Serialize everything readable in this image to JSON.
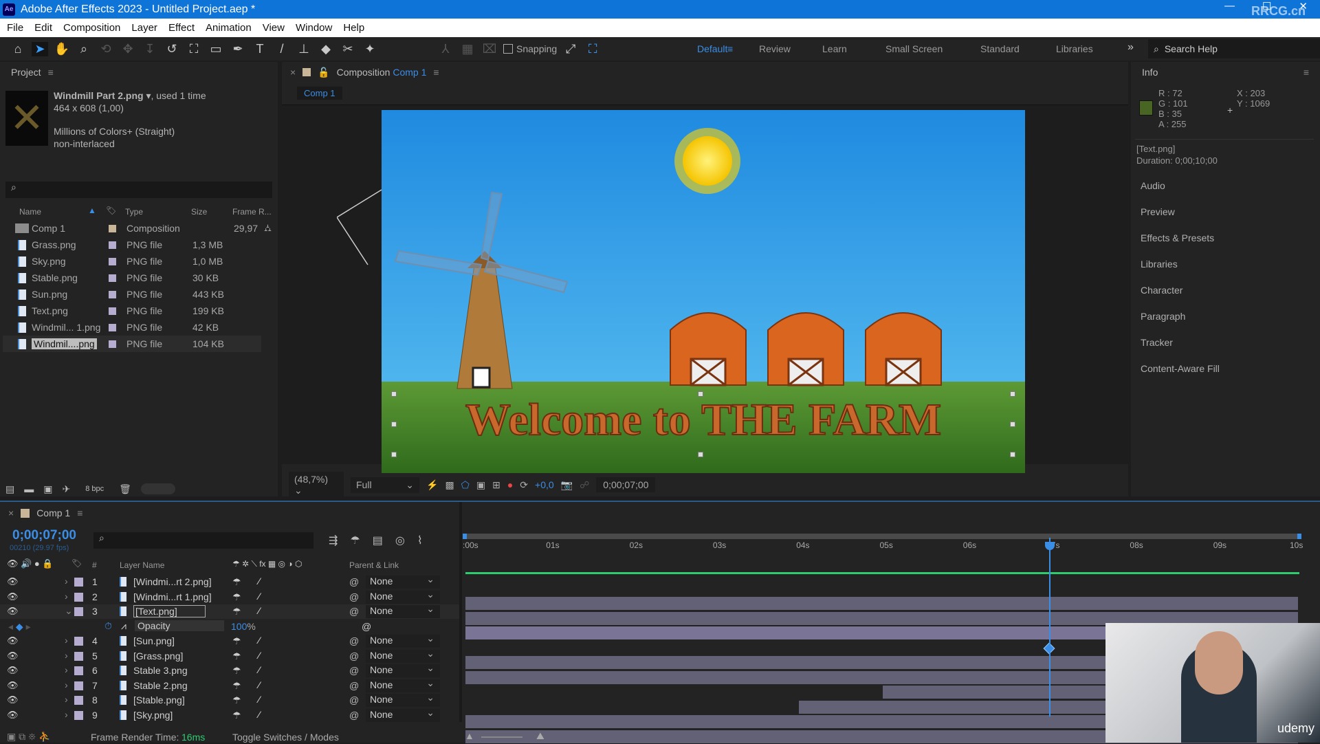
{
  "window": {
    "title": "Adobe After Effects 2023 - Untitled Project.aep *",
    "app_badge": "Ae",
    "watermark": "RRCG.cn"
  },
  "menu": [
    "File",
    "Edit",
    "Composition",
    "Layer",
    "Effect",
    "Animation",
    "View",
    "Window",
    "Help"
  ],
  "toolbar": {
    "snapping_label": "Snapping",
    "workspaces": [
      "Default",
      "Review",
      "Learn",
      "Small Screen",
      "Standard",
      "Libraries"
    ],
    "active_workspace": "Default",
    "search_placeholder": "Search Help"
  },
  "project": {
    "title": "Project",
    "selected": {
      "name": "Windmill Part 2.png",
      "used": ", used 1 time",
      "dims": "464 x 608 (1,00)",
      "colors": "Millions of Colors+ (Straight)",
      "interlace": "non-interlaced"
    },
    "columns": {
      "name": "Name",
      "type": "Type",
      "size": "Size",
      "frame_rate": "Frame R..."
    },
    "items": [
      {
        "name": "Comp 1",
        "type": "Composition",
        "size": "",
        "fr": "29,97",
        "kind": "comp"
      },
      {
        "name": "Grass.png",
        "type": "PNG file",
        "size": "1,3 MB",
        "fr": ""
      },
      {
        "name": "Sky.png",
        "type": "PNG file",
        "size": "1,0 MB",
        "fr": ""
      },
      {
        "name": "Stable.png",
        "type": "PNG file",
        "size": "30 KB",
        "fr": ""
      },
      {
        "name": "Sun.png",
        "type": "PNG file",
        "size": "443 KB",
        "fr": ""
      },
      {
        "name": "Text.png",
        "type": "PNG file",
        "size": "199 KB",
        "fr": ""
      },
      {
        "name": "Windmil... 1.png",
        "type": "PNG file",
        "size": "42 KB",
        "fr": ""
      },
      {
        "name": "Windmil....png",
        "type": "PNG file",
        "size": "104 KB",
        "fr": "",
        "selected": true
      }
    ],
    "bpc": "8 bpc"
  },
  "composition": {
    "panel_label": "Composition",
    "comp_name": "Comp 1",
    "tab": "Comp 1",
    "zoom": "(48,7%)",
    "resolution": "Full",
    "exposure": "+0,0",
    "timecode": "0;00;07;00",
    "scene_text": "Welcome to THE FARM"
  },
  "info": {
    "title": "Info",
    "r": "R : 72",
    "g": "G : 101",
    "b": "B : 35",
    "a": "A : 255",
    "x": "X : 203",
    "y": "Y : 1069",
    "swatch": "#486523",
    "layer": "[Text.png]",
    "duration": "Duration: 0;00;10;00",
    "panels": [
      "Audio",
      "Preview",
      "Effects & Presets",
      "Libraries",
      "Character",
      "Paragraph",
      "Tracker",
      "Content-Aware Fill"
    ]
  },
  "timeline": {
    "tab": "Comp 1",
    "timecode": "0;00;07;00",
    "frames": "00210 (29.97 fps)",
    "col_layer_name": "Layer Name",
    "col_num": "#",
    "col_parent": "Parent & Link",
    "ruler": [
      ":00s",
      "01s",
      "02s",
      "03s",
      "04s",
      "05s",
      "06s",
      "07s",
      "08s",
      "09s",
      "10s"
    ],
    "current_time_s": 7,
    "duration_s": 10,
    "layers": [
      {
        "num": "1",
        "name": "[Windmi...rt 2.png]",
        "parent": "None",
        "in": 0
      },
      {
        "num": "2",
        "name": "[Windmi...rt 1.png]",
        "parent": "None",
        "in": 0
      },
      {
        "num": "3",
        "name": "[Text.png]",
        "parent": "None",
        "in": 0,
        "selected": true,
        "expanded": true
      },
      {
        "num": "4",
        "name": "[Sun.png]",
        "parent": "None",
        "in": 0
      },
      {
        "num": "5",
        "name": "[Grass.png]",
        "parent": "None",
        "in": 0
      },
      {
        "num": "6",
        "name": "Stable 3.png",
        "parent": "None",
        "in": 5
      },
      {
        "num": "7",
        "name": "Stable 2.png",
        "parent": "None",
        "in": 4
      },
      {
        "num": "8",
        "name": "[Stable.png]",
        "parent": "None",
        "in": 0
      },
      {
        "num": "9",
        "name": "[Sky.png]",
        "parent": "None",
        "in": 0
      }
    ],
    "property": {
      "name": "Opacity",
      "value": "100",
      "unit": "%",
      "keyframe_s": 7
    },
    "footer": {
      "render_label": "Frame Render Time:",
      "render_value": "16ms",
      "toggle": "Toggle Switches / Modes"
    }
  },
  "overlay": {
    "brand": "udemy"
  },
  "colors": {
    "accent": "#3a8ee6",
    "titlebar": "#0e74d8",
    "green_ms": "#2ecc71"
  }
}
